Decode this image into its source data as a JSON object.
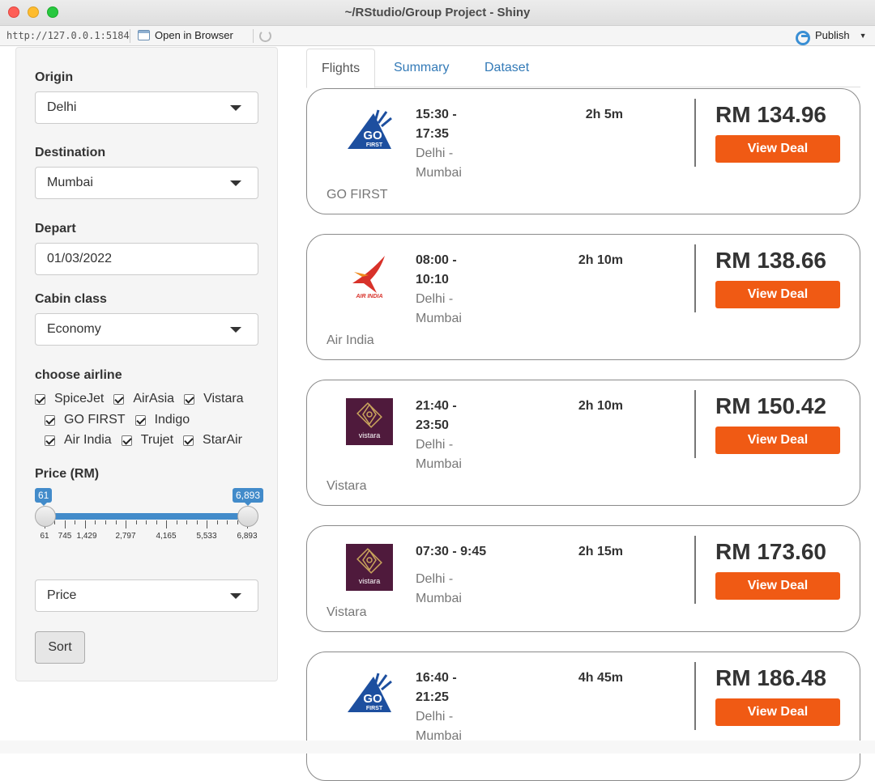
{
  "window": {
    "title": "~/RStudio/Group Project - Shiny"
  },
  "toolbar": {
    "url": "http://127.0.0.1:5184",
    "open_browser": "Open in Browser",
    "publish": "Publish"
  },
  "sidebar": {
    "origin_label": "Origin",
    "origin_value": "Delhi",
    "destination_label": "Destination",
    "destination_value": "Mumbai",
    "depart_label": "Depart",
    "depart_value": "01/03/2022",
    "cabin_label": "Cabin class",
    "cabin_value": "Economy",
    "airline_label": "choose airline",
    "airlines": [
      {
        "name": "SpiceJet",
        "checked": true
      },
      {
        "name": "AirAsia",
        "checked": true
      },
      {
        "name": "Vistara",
        "checked": true
      },
      {
        "name": "GO FIRST",
        "checked": true
      },
      {
        "name": "Indigo",
        "checked": true
      },
      {
        "name": "Air India",
        "checked": true
      },
      {
        "name": "Trujet",
        "checked": true
      },
      {
        "name": "StarAir",
        "checked": true
      }
    ],
    "price_label": "Price (RM)",
    "price_min": "61",
    "price_max": "6,893",
    "price_ticks": [
      "61",
      "745",
      "1,429",
      "2,797",
      "4,165",
      "5,533",
      "6,893"
    ],
    "sort_value": "Price",
    "sort_button": "Sort"
  },
  "tabs": [
    {
      "label": "Flights",
      "active": true
    },
    {
      "label": "Summary",
      "active": false
    },
    {
      "label": "Dataset",
      "active": false
    }
  ],
  "flights": [
    {
      "airline": "GO FIRST",
      "logo": "go-first-logo",
      "depart": "15:30 -",
      "arrive": "17:35",
      "origin": "Delhi -",
      "destination": "Mumbai",
      "duration": "2h 5m",
      "price": "RM 134.96",
      "deal": "View Deal"
    },
    {
      "airline": "Air India",
      "logo": "air-india-logo",
      "depart": "08:00 -",
      "arrive": "10:10",
      "origin": "Delhi -",
      "destination": "Mumbai",
      "duration": "2h 10m",
      "price": "RM 138.66",
      "deal": "View Deal"
    },
    {
      "airline": "Vistara",
      "logo": "vistara-logo",
      "depart": "21:40 -",
      "arrive": "23:50",
      "origin": "Delhi -",
      "destination": "Mumbai",
      "duration": "2h 10m",
      "price": "RM 150.42",
      "deal": "View Deal"
    },
    {
      "airline": "Vistara",
      "logo": "vistara-logo",
      "depart": "07:30 - 9:45",
      "arrive": "",
      "origin": "Delhi -",
      "destination": "Mumbai",
      "duration": "2h 15m",
      "price": "RM 173.60",
      "deal": "View Deal"
    },
    {
      "airline": "GO FIRST",
      "logo": "go-first-logo",
      "depart": "16:40 -",
      "arrive": "21:25",
      "origin": "Delhi -",
      "destination": "Mumbai",
      "duration": "4h 45m",
      "price": "RM 186.48",
      "deal": "View Deal"
    }
  ],
  "logos": {
    "go_first_text": "GO",
    "go_first_sub": "FIRST",
    "air_india_text": "AIR INDIA",
    "vistara_text": "vistara"
  },
  "colors": {
    "accent": "#337ab7",
    "slider": "#428bca",
    "deal_button": "#f05a14",
    "vistara": "#4f1a3c",
    "go_first": "#1d4f9f",
    "air_india": "#d8322a"
  }
}
